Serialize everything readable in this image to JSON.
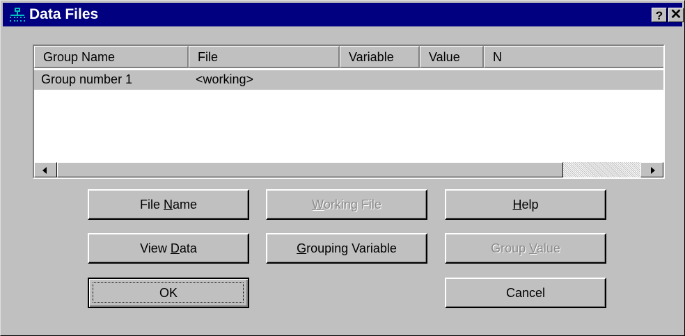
{
  "window": {
    "title": "Data Files",
    "help_glyph": "?",
    "close_glyph": "✕"
  },
  "listview": {
    "columns": [
      "Group Name",
      "File",
      "Variable",
      "Value",
      "N"
    ],
    "rows": [
      {
        "group_name": "Group number 1",
        "file": "<working>",
        "variable": "",
        "value": "",
        "n": ""
      }
    ]
  },
  "buttons": {
    "file_name": {
      "pre": "File ",
      "accel": "N",
      "post": "ame"
    },
    "working_file": {
      "pre": "",
      "accel": "W",
      "post": "orking File"
    },
    "help": {
      "pre": "",
      "accel": "H",
      "post": "elp"
    },
    "view_data": {
      "pre": "View ",
      "accel": "D",
      "post": "ata"
    },
    "grouping_variable": {
      "pre": "",
      "accel": "G",
      "post": "rouping Variable"
    },
    "group_value": {
      "pre": "Group ",
      "accel": "V",
      "post": "alue"
    },
    "ok": "OK",
    "cancel": "Cancel"
  },
  "colors": {
    "titlebar": "#000080",
    "face": "#c0c0c0",
    "disabled_text": "#8a8a8a"
  }
}
